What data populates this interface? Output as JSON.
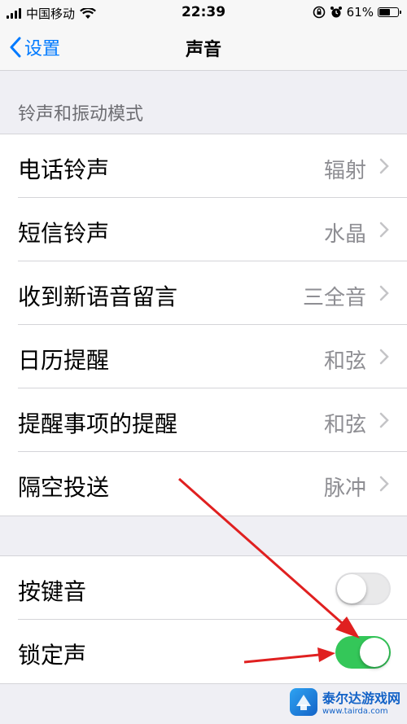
{
  "status_bar": {
    "carrier": "中国移动",
    "time": "22:39",
    "battery": "61%",
    "battery_level": 0.61
  },
  "nav": {
    "back_label": "设置",
    "title": "声音"
  },
  "section": {
    "header": "铃声和振动模式"
  },
  "ringtones": [
    {
      "label": "电话铃声",
      "value": "辐射"
    },
    {
      "label": "短信铃声",
      "value": "水晶"
    },
    {
      "label": "收到新语音留言",
      "value": "三全音"
    },
    {
      "label": "日历提醒",
      "value": "和弦"
    },
    {
      "label": "提醒事项的提醒",
      "value": "和弦"
    },
    {
      "label": "隔空投送",
      "value": "脉冲"
    }
  ],
  "toggles": [
    {
      "label": "按键音",
      "state": "off"
    },
    {
      "label": "锁定声",
      "state": "on"
    }
  ],
  "colors": {
    "accent": "#007aff",
    "toggle_on": "#34c759",
    "annotation": "#e02020"
  },
  "watermark": {
    "name": "泰尔达游戏网",
    "url": "www.tairda.com"
  }
}
